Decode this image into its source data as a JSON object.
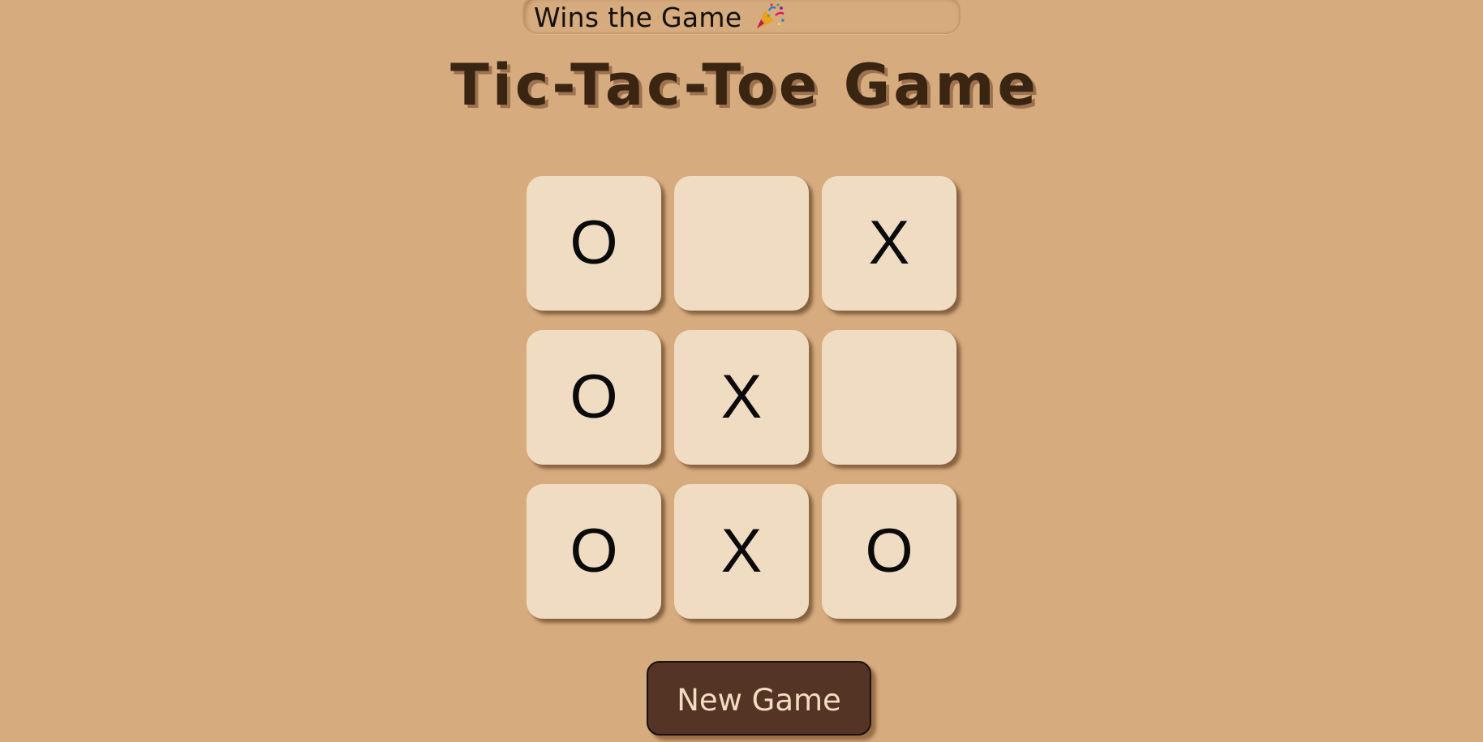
{
  "status": {
    "message": "Wins the Game",
    "icon": "party-popper-icon"
  },
  "header": {
    "title": "Tic-Tac-Toe Game"
  },
  "board": {
    "cells": [
      "O",
      "",
      "X",
      "O",
      "X",
      "",
      "O",
      "X",
      "O"
    ]
  },
  "controls": {
    "new_game_label": "New Game"
  },
  "colors": {
    "background": "#d6ab7e",
    "cell": "#f0dcc2",
    "title": "#3a2412",
    "button": "#543425",
    "button_text": "#f3dcc0"
  }
}
